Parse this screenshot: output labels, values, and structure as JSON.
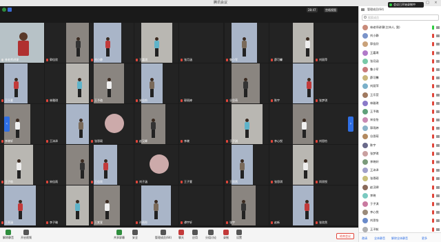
{
  "window": {
    "title": "腾讯会议"
  },
  "topbar": {
    "view_label": "宫格视图",
    "time_label": "28:47"
  },
  "status": {
    "recording_label": "会议已开始录制中"
  },
  "tiles": [
    {
      "name": "林老师讲课",
      "mic": "on"
    },
    {
      "name": "郭佳欣",
      "mic": "off"
    },
    {
      "name": "刘小静",
      "mic": "off"
    },
    {
      "name": "王嘉琪",
      "mic": "off"
    },
    {
      "name": "张月涵",
      "mic": "off"
    },
    {
      "name": "鲁小军",
      "mic": "off"
    },
    {
      "name": "薛可馨",
      "mic": "off"
    },
    {
      "name": "刘丽萍",
      "mic": "off"
    },
    {
      "name": "王乐萱",
      "mic": "off"
    },
    {
      "name": "林雅琪",
      "mic": "off"
    },
    {
      "name": "王予璐",
      "mic": "off"
    },
    {
      "name": "宋佳怡",
      "mic": "off"
    },
    {
      "name": "郭雨婷",
      "mic": "off"
    },
    {
      "name": "谷思萌",
      "mic": "off"
    },
    {
      "name": "陈宇",
      "mic": "off"
    },
    {
      "name": "张梦琪",
      "mic": "off"
    },
    {
      "name": "李晓轩",
      "mic": "off"
    },
    {
      "name": "王沛泽",
      "mic": "off"
    },
    {
      "name": "张恩硕",
      "mic": "off"
    },
    {
      "name": "赵汉卿",
      "mic": "off"
    },
    {
      "name": "李晓",
      "mic": "off"
    },
    {
      "name": "于子淇",
      "mic": "off"
    },
    {
      "name": "李心悦",
      "mic": "off"
    },
    {
      "name": "刘思怡",
      "mic": "off"
    },
    {
      "name": "王子航",
      "mic": "off"
    },
    {
      "name": "宋佳雨",
      "mic": "off"
    },
    {
      "name": "王佳欣",
      "mic": "off"
    },
    {
      "name": "刘子涵",
      "mic": "off"
    },
    {
      "name": "王子萱",
      "mic": "off"
    },
    {
      "name": "王欣然",
      "mic": "off"
    },
    {
      "name": "张思琪",
      "mic": "off"
    },
    {
      "name": "尚欣悦",
      "mic": "off"
    },
    {
      "name": "王雨涵",
      "mic": "off"
    },
    {
      "name": "李子瑜",
      "mic": "off"
    },
    {
      "name": "王紫萱",
      "mic": "off"
    },
    {
      "name": "孙雨彤",
      "mic": "off"
    },
    {
      "name": "谭宇轩",
      "mic": "off"
    },
    {
      "name": "张宇",
      "mic": "off"
    },
    {
      "name": "赵新",
      "mic": "off"
    },
    {
      "name": "张欣然",
      "mic": "off"
    },
    {
      "name": "范子涵",
      "mic": "off"
    },
    {
      "name": "王欣阳",
      "mic": "off"
    },
    {
      "name": "于欣悦",
      "mic": "off"
    },
    {
      "name": "张馨月",
      "mic": "off"
    },
    {
      "name": "王悦",
      "mic": "off"
    },
    {
      "name": "刘一凡",
      "mic": "off"
    },
    {
      "name": "翟宇轩",
      "mic": "off"
    },
    {
      "name": "王晨曦",
      "mic": "off"
    },
    {
      "name": "张佳琪",
      "mic": "off"
    },
    {
      "name": "李子欣",
      "mic": "off"
    },
    {
      "name": "王雨萱",
      "mic": "off"
    },
    {
      "name": "赵子涵",
      "mic": "off"
    },
    {
      "name": "刘梦瑶",
      "mic": "off"
    },
    {
      "name": "孟子琪",
      "mic": "off"
    },
    {
      "name": "王子欣",
      "mic": "off"
    },
    {
      "name": "李梓涵",
      "mic": "off"
    },
    {
      "name": "张一诺",
      "mic": "off"
    },
    {
      "name": "王佳琪",
      "mic": "off"
    },
    {
      "name": "刘欣怡",
      "mic": "off"
    },
    {
      "name": "张梓萱",
      "mic": "off"
    },
    {
      "name": "王梓涵",
      "mic": "off"
    },
    {
      "name": "李欣妍",
      "mic": "off"
    },
    {
      "name": "刘雨涵",
      "mic": "off"
    },
    {
      "name": "赵欣然",
      "mic": "off"
    }
  ],
  "panel": {
    "header": "管理成员(64)",
    "search_placeholder": "搜索成员",
    "members": [
      {
        "name": "林老师讲课(主持人, 我)",
        "color": "#c98b7a"
      },
      {
        "name": "刘小静",
        "color": "#7a93c9"
      },
      {
        "name": "郭佳欣",
        "color": "#c9a27a"
      },
      {
        "name": "王嘉琪",
        "color": "#b07ac9"
      },
      {
        "name": "张月涵",
        "color": "#7ac9a8"
      },
      {
        "name": "鲁小军",
        "color": "#c97a7a"
      },
      {
        "name": "薛可馨",
        "color": "#c9b67a"
      },
      {
        "name": "刘丽萍",
        "color": "#7ab0c9"
      },
      {
        "name": "王乐萱",
        "color": "#a07a60"
      },
      {
        "name": "林雅琪",
        "color": "#8a7ac9"
      },
      {
        "name": "王予璐",
        "color": "#60a07a"
      },
      {
        "name": "宋佳怡",
        "color": "#c98ab3"
      },
      {
        "name": "郭雨婷",
        "color": "#8ab3c9"
      },
      {
        "name": "谷思萌",
        "color": "#b38a60"
      },
      {
        "name": "陈宇",
        "color": "#6a6a8a"
      },
      {
        "name": "张梦琪",
        "color": "#c9a0a0"
      },
      {
        "name": "李晓轩",
        "color": "#7a9a7a"
      },
      {
        "name": "王沛泽",
        "color": "#a0a0c9"
      },
      {
        "name": "张恩硕",
        "color": "#c9c07a"
      },
      {
        "name": "赵汉卿",
        "color": "#8a6a5a"
      },
      {
        "name": "李晓",
        "color": "#7ac9c0"
      },
      {
        "name": "于子淇",
        "color": "#c97aa0"
      },
      {
        "name": "李心悦",
        "color": "#9a8a7a"
      },
      {
        "name": "刘思怡",
        "color": "#6a8ac9"
      },
      {
        "name": "王子航",
        "color": "#b0b0b0"
      }
    ],
    "footer": {
      "invite": "邀请",
      "mute_all": "全体静音",
      "unmute_all": "解除全体静音",
      "more": "更多"
    }
  },
  "toolbar": {
    "items": [
      {
        "id": "mute",
        "label": "解除静音",
        "icon": "mic-icon"
      },
      {
        "id": "video",
        "label": "开启视频",
        "icon": "camera-icon"
      },
      {
        "id": "share",
        "label": "共享屏幕",
        "icon": "share-screen-icon"
      },
      {
        "id": "security",
        "label": "安全",
        "icon": "shield-icon"
      },
      {
        "id": "members",
        "label": "管理成员(64)",
        "icon": "people-icon"
      },
      {
        "id": "chat",
        "label": "聊天",
        "icon": "chat-icon"
      },
      {
        "id": "apps",
        "label": "应用",
        "icon": "apps-icon"
      },
      {
        "id": "breakout",
        "label": "分组讨论",
        "icon": "breakout-icon"
      },
      {
        "id": "record",
        "label": "录制",
        "icon": "record-icon"
      },
      {
        "id": "settings",
        "label": "设置",
        "icon": "gear-icon"
      }
    ],
    "end_label": "结束会议"
  }
}
